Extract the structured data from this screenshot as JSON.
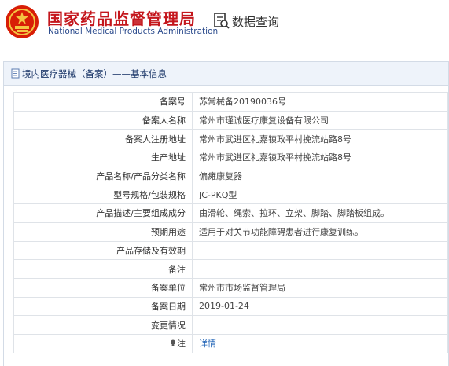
{
  "header": {
    "title_cn": "国家药品监督管理局",
    "title_en": "National Medical Products Administration",
    "query_label": "数据查询",
    "query_icon": "search-doc-icon",
    "emblem_icon": "national-emblem-icon"
  },
  "panel": {
    "title": "境内医疗器械（备案）——基本信息",
    "icon": "document-icon"
  },
  "rows": [
    {
      "label": "备案号",
      "value": "苏常械备20190036号"
    },
    {
      "label": "备案人名称",
      "value": "常州市瑾诚医疗康复设备有限公司"
    },
    {
      "label": "备案人注册地址",
      "value": "常州市武进区礼嘉镇政平村挽流站路8号"
    },
    {
      "label": "生产地址",
      "value": "常州市武进区礼嘉镇政平村挽流站路8号"
    },
    {
      "label": "产品名称/产品分类名称",
      "value": "偏瘫康复器"
    },
    {
      "label": "型号规格/包装规格",
      "value": "JC-PKQ型"
    },
    {
      "label": "产品描述/主要组成成分",
      "value": "由滑轮、绳索、拉环、立架、脚踏、脚踏板组成。"
    },
    {
      "label": "预期用途",
      "value": "适用于对关节功能障碍患者进行康复训练。"
    },
    {
      "label": "产品存储及有效期",
      "value": ""
    },
    {
      "label": "备注",
      "value": ""
    },
    {
      "label": "备案单位",
      "value": "常州市市场监督管理局"
    },
    {
      "label": "备案日期",
      "value": "2019-01-24"
    },
    {
      "label": "变更情况",
      "value": ""
    }
  ],
  "note": {
    "label": "注",
    "link_text": "详情",
    "icon": "lightbulb-icon"
  },
  "colors": {
    "brand_red": "#c4161c",
    "brand_blue": "#2a4a8c",
    "link": "#1a5fb4"
  }
}
